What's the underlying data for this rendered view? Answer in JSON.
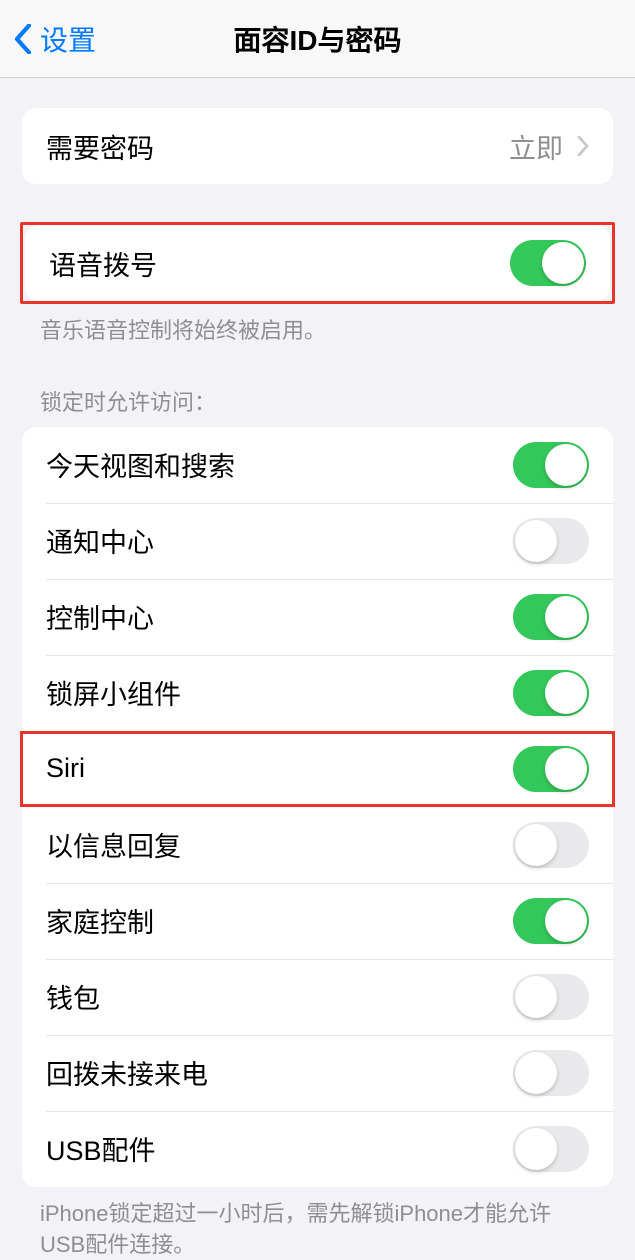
{
  "header": {
    "back_label": "设置",
    "title": "面容ID与密码"
  },
  "require_passcode": {
    "label": "需要密码",
    "value": "立即"
  },
  "voice_dial": {
    "label": "语音拨号",
    "on": true,
    "footer": "音乐语音控制将始终被启用。"
  },
  "lock_section": {
    "header": "锁定时允许访问：",
    "items": [
      {
        "label": "今天视图和搜索",
        "on": true
      },
      {
        "label": "通知中心",
        "on": false
      },
      {
        "label": "控制中心",
        "on": true
      },
      {
        "label": "锁屏小组件",
        "on": true
      },
      {
        "label": "Siri",
        "on": true
      },
      {
        "label": "以信息回复",
        "on": false
      },
      {
        "label": "家庭控制",
        "on": true
      },
      {
        "label": "钱包",
        "on": false
      },
      {
        "label": "回拨未接来电",
        "on": false
      },
      {
        "label": "USB配件",
        "on": false
      }
    ],
    "footer": "iPhone锁定超过一小时后，需先解锁iPhone才能允许USB配件连接。"
  }
}
